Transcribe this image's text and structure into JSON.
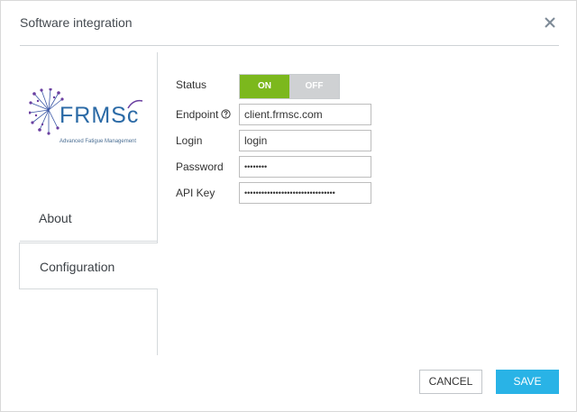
{
  "dialog": {
    "title": "Software integration",
    "close_icon": "close-icon"
  },
  "logo": {
    "brand": "FRMSc",
    "tagline": "Advanced Fatigue Management",
    "colors": {
      "primary": "#2b6aa6",
      "accent": "#6a3fa0"
    }
  },
  "sidebar": {
    "items": [
      {
        "label": "About",
        "active": false
      },
      {
        "label": "Configuration",
        "active": true
      }
    ]
  },
  "form": {
    "status": {
      "label": "Status",
      "on_label": "ON",
      "off_label": "OFF",
      "value": "ON",
      "on_color": "#7cb81d",
      "off_color": "#cfd1d3"
    },
    "endpoint": {
      "label": "Endpoint",
      "value": "client.frmsc.com",
      "help_icon": "question-circle-icon"
    },
    "login": {
      "label": "Login",
      "value": "login"
    },
    "password": {
      "label": "Password",
      "value": "••••••••"
    },
    "api_key": {
      "label": "API Key",
      "value": "••••••••••••••••••••••••••••••••"
    }
  },
  "footer": {
    "cancel_label": "CANCEL",
    "save_label": "SAVE",
    "save_color": "#29b3e6"
  }
}
